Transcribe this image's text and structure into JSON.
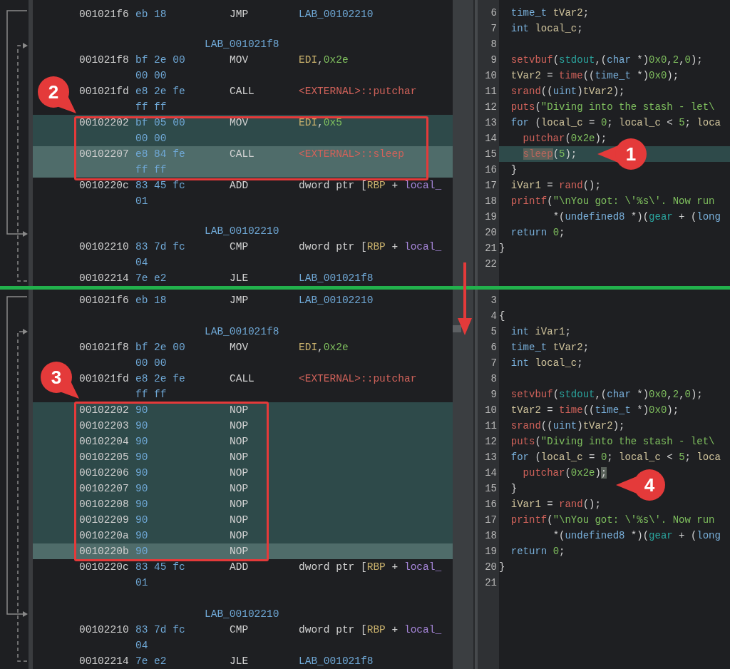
{
  "panes": [
    {
      "listing": {
        "rows": [
          {
            "kind": "instruction",
            "address": "001021f6",
            "bytes": [
              "eb 18"
            ],
            "mnemonic": "JMP",
            "operands": [
              {
                "text": "LAB_00102210",
                "kind": "label"
              }
            ],
            "selected": false,
            "cursor": false
          },
          {
            "kind": "blank",
            "selected": false,
            "cursor": false
          },
          {
            "kind": "label",
            "text": "LAB_001021f8",
            "selected": false,
            "cursor": false
          },
          {
            "kind": "instruction",
            "address": "001021f8",
            "bytes": [
              "bf 2e 00",
              "00 00"
            ],
            "mnemonic": "MOV",
            "operands": [
              {
                "text": "EDI",
                "kind": "register"
              },
              {
                "text": ",",
                "kind": "plain"
              },
              {
                "text": "0x2e",
                "kind": "number"
              }
            ],
            "selected": false,
            "cursor": false
          },
          {
            "kind": "instruction",
            "address": "001021fd",
            "bytes": [
              "e8 2e fe",
              "ff ff"
            ],
            "mnemonic": "CALL",
            "operands": [
              {
                "text": "<EXTERNAL>::putchar",
                "kind": "external"
              }
            ],
            "selected": false,
            "cursor": false
          },
          {
            "kind": "instruction",
            "address": "00102202",
            "bytes": [
              "bf 05 00",
              "00 00"
            ],
            "mnemonic": "MOV",
            "operands": [
              {
                "text": "EDI",
                "kind": "register"
              },
              {
                "text": ",",
                "kind": "plain"
              },
              {
                "text": "0x5",
                "kind": "number"
              }
            ],
            "selected": true,
            "cursor": false
          },
          {
            "kind": "instruction",
            "address": "00102207",
            "bytes": [
              "e8 84 fe",
              "ff ff"
            ],
            "mnemonic": "CALL",
            "operands": [
              {
                "text": "<EXTERNAL>::sleep",
                "kind": "external"
              }
            ],
            "selected": true,
            "cursor": true
          },
          {
            "kind": "instruction",
            "address": "0010220c",
            "bytes": [
              "83 45 fc",
              "01"
            ],
            "mnemonic": "ADD",
            "operands": [
              {
                "text": "dword ptr [",
                "kind": "plain"
              },
              {
                "text": "RBP",
                "kind": "register"
              },
              {
                "text": " + ",
                "kind": "plain"
              },
              {
                "text": "local_",
                "kind": "variable"
              }
            ],
            "selected": false,
            "cursor": false
          },
          {
            "kind": "blank",
            "selected": false,
            "cursor": false
          },
          {
            "kind": "label",
            "text": "LAB_00102210",
            "selected": false,
            "cursor": false
          },
          {
            "kind": "instruction",
            "address": "00102210",
            "bytes": [
              "83 7d fc",
              "04"
            ],
            "mnemonic": "CMP",
            "operands": [
              {
                "text": "dword ptr [",
                "kind": "plain"
              },
              {
                "text": "RBP",
                "kind": "register"
              },
              {
                "text": " + ",
                "kind": "plain"
              },
              {
                "text": "local_",
                "kind": "variable"
              }
            ],
            "selected": false,
            "cursor": false
          },
          {
            "kind": "instruction",
            "address": "00102214",
            "bytes": [
              "7e e2"
            ],
            "mnemonic": "JLE",
            "operands": [
              {
                "text": "LAB_001021f8",
                "kind": "label"
              }
            ],
            "selected": false,
            "cursor": false
          }
        ]
      },
      "decompiler": {
        "lines": [
          {
            "number": "6",
            "selected": false,
            "tokens": [
              {
                "text": "  time_t",
                "kind": "type"
              },
              {
                "text": " tVar2",
                "kind": "var"
              },
              {
                "text": ";",
                "kind": "plain"
              }
            ]
          },
          {
            "number": "7",
            "selected": false,
            "tokens": [
              {
                "text": "  int",
                "kind": "type"
              },
              {
                "text": " local_c",
                "kind": "var"
              },
              {
                "text": ";",
                "kind": "plain"
              }
            ]
          },
          {
            "number": "8",
            "selected": false
          },
          {
            "number": "9",
            "selected": false,
            "tokens": [
              {
                "text": "  setvbuf",
                "kind": "func"
              },
              {
                "text": "(",
                "kind": "plain"
              },
              {
                "text": "stdout",
                "kind": "global"
              },
              {
                "text": ",(",
                "kind": "plain"
              },
              {
                "text": "char",
                "kind": "type"
              },
              {
                "text": " *)",
                "kind": "plain"
              },
              {
                "text": "0x0",
                "kind": "number"
              },
              {
                "text": ",",
                "kind": "plain"
              },
              {
                "text": "2",
                "kind": "number"
              },
              {
                "text": ",",
                "kind": "plain"
              },
              {
                "text": "0",
                "kind": "number"
              },
              {
                "text": ");",
                "kind": "plain"
              }
            ]
          },
          {
            "number": "10",
            "selected": false,
            "tokens": [
              {
                "text": "  tVar2",
                "kind": "var"
              },
              {
                "text": " =",
                "kind": "plain"
              },
              {
                "text": " time",
                "kind": "func"
              },
              {
                "text": "((",
                "kind": "plain"
              },
              {
                "text": "time_t",
                "kind": "type"
              },
              {
                "text": " *)",
                "kind": "plain"
              },
              {
                "text": "0x0",
                "kind": "number"
              },
              {
                "text": ");",
                "kind": "plain"
              }
            ]
          },
          {
            "number": "11",
            "selected": false,
            "tokens": [
              {
                "text": "  srand",
                "kind": "func"
              },
              {
                "text": "((",
                "kind": "plain"
              },
              {
                "text": "uint",
                "kind": "type"
              },
              {
                "text": ")",
                "kind": "plain"
              },
              {
                "text": "tVar2",
                "kind": "var"
              },
              {
                "text": ");",
                "kind": "plain"
              }
            ]
          },
          {
            "number": "12",
            "selected": false,
            "tokens": [
              {
                "text": "  puts",
                "kind": "func"
              },
              {
                "text": "(",
                "kind": "plain"
              },
              {
                "text": "\"Diving into the stash - let\\",
                "kind": "string"
              }
            ]
          },
          {
            "number": "13",
            "selected": false,
            "tokens": [
              {
                "text": "  for",
                "kind": "type"
              },
              {
                "text": " (",
                "kind": "plain"
              },
              {
                "text": "local_c",
                "kind": "var"
              },
              {
                "text": " =",
                "kind": "plain"
              },
              {
                "text": " 0",
                "kind": "number"
              },
              {
                "text": ";",
                "kind": "plain"
              },
              {
                "text": " local_c",
                "kind": "var"
              },
              {
                "text": " <",
                "kind": "plain"
              },
              {
                "text": " 5",
                "kind": "number"
              },
              {
                "text": ";",
                "kind": "plain"
              },
              {
                "text": " loca",
                "kind": "var"
              }
            ]
          },
          {
            "number": "14",
            "selected": false,
            "tokens": [
              {
                "text": "    putchar",
                "kind": "func"
              },
              {
                "text": "(",
                "kind": "plain"
              },
              {
                "text": "0x2e",
                "kind": "number"
              },
              {
                "text": ");",
                "kind": "plain"
              }
            ]
          },
          {
            "number": "15",
            "selected": true,
            "tokens": [
              {
                "text": "    sleep",
                "kind": "markedfunc"
              },
              {
                "text": "(",
                "kind": "plain"
              },
              {
                "text": "5",
                "kind": "number"
              },
              {
                "text": ");",
                "kind": "plain"
              }
            ]
          },
          {
            "number": "16",
            "selected": false,
            "tokens": [
              {
                "text": "  }",
                "kind": "plain"
              }
            ]
          },
          {
            "number": "17",
            "selected": false,
            "tokens": [
              {
                "text": "  iVar1",
                "kind": "var"
              },
              {
                "text": " =",
                "kind": "plain"
              },
              {
                "text": " rand",
                "kind": "func"
              },
              {
                "text": "();",
                "kind": "plain"
              }
            ]
          },
          {
            "number": "18",
            "selected": false,
            "tokens": [
              {
                "text": "  printf",
                "kind": "func"
              },
              {
                "text": "(",
                "kind": "plain"
              },
              {
                "text": "\"\\nYou got: \\'%s\\'. Now run",
                "kind": "string"
              }
            ]
          },
          {
            "number": "19",
            "selected": false,
            "tokens": [
              {
                "text": "         *(",
                "kind": "plain"
              },
              {
                "text": "undefined8",
                "kind": "type"
              },
              {
                "text": " *)(",
                "kind": "plain"
              },
              {
                "text": "gear",
                "kind": "global"
              },
              {
                "text": " + (",
                "kind": "plain"
              },
              {
                "text": "long",
                "kind": "type"
              }
            ]
          },
          {
            "number": "20",
            "selected": false,
            "tokens": [
              {
                "text": "  return",
                "kind": "type"
              },
              {
                "text": " 0",
                "kind": "number"
              },
              {
                "text": ";",
                "kind": "plain"
              }
            ]
          },
          {
            "number": "21",
            "selected": false,
            "tokens": [
              {
                "text": "}",
                "kind": "plain"
              }
            ]
          },
          {
            "number": "22",
            "selected": false
          }
        ]
      }
    },
    {
      "listing": {
        "rows": [
          {
            "kind": "instruction",
            "address": "001021f6",
            "bytes": [
              "eb 18"
            ],
            "mnemonic": "JMP",
            "operands": [
              {
                "text": "LAB_00102210",
                "kind": "label"
              }
            ],
            "selected": false,
            "cursor": false
          },
          {
            "kind": "blank",
            "selected": false,
            "cursor": false
          },
          {
            "kind": "label",
            "text": "LAB_001021f8",
            "selected": false,
            "cursor": false
          },
          {
            "kind": "instruction",
            "address": "001021f8",
            "bytes": [
              "bf 2e 00",
              "00 00"
            ],
            "mnemonic": "MOV",
            "operands": [
              {
                "text": "EDI",
                "kind": "register"
              },
              {
                "text": ",",
                "kind": "plain"
              },
              {
                "text": "0x2e",
                "kind": "number"
              }
            ],
            "selected": false,
            "cursor": false
          },
          {
            "kind": "instruction",
            "address": "001021fd",
            "bytes": [
              "e8 2e fe",
              "ff ff"
            ],
            "mnemonic": "CALL",
            "operands": [
              {
                "text": "<EXTERNAL>::putchar",
                "kind": "external"
              }
            ],
            "selected": false,
            "cursor": false
          },
          {
            "kind": "instruction",
            "address": "00102202",
            "bytes": [
              "90"
            ],
            "mnemonic": "NOP",
            "selected": true,
            "cursor": false
          },
          {
            "kind": "instruction",
            "address": "00102203",
            "bytes": [
              "90"
            ],
            "mnemonic": "NOP",
            "selected": true,
            "cursor": false
          },
          {
            "kind": "instruction",
            "address": "00102204",
            "bytes": [
              "90"
            ],
            "mnemonic": "NOP",
            "selected": true,
            "cursor": false
          },
          {
            "kind": "instruction",
            "address": "00102205",
            "bytes": [
              "90"
            ],
            "mnemonic": "NOP",
            "selected": true,
            "cursor": false
          },
          {
            "kind": "instruction",
            "address": "00102206",
            "bytes": [
              "90"
            ],
            "mnemonic": "NOP",
            "selected": true,
            "cursor": false
          },
          {
            "kind": "instruction",
            "address": "00102207",
            "bytes": [
              "90"
            ],
            "mnemonic": "NOP",
            "selected": true,
            "cursor": false
          },
          {
            "kind": "instruction",
            "address": "00102208",
            "bytes": [
              "90"
            ],
            "mnemonic": "NOP",
            "selected": true,
            "cursor": false
          },
          {
            "kind": "instruction",
            "address": "00102209",
            "bytes": [
              "90"
            ],
            "mnemonic": "NOP",
            "selected": true,
            "cursor": false
          },
          {
            "kind": "instruction",
            "address": "0010220a",
            "bytes": [
              "90"
            ],
            "mnemonic": "NOP",
            "selected": true,
            "cursor": false
          },
          {
            "kind": "instruction",
            "address": "0010220b",
            "bytes": [
              "90"
            ],
            "mnemonic": "NOP",
            "selected": true,
            "cursor": true
          },
          {
            "kind": "instruction",
            "address": "0010220c",
            "bytes": [
              "83 45 fc",
              "01"
            ],
            "mnemonic": "ADD",
            "operands": [
              {
                "text": "dword ptr [",
                "kind": "plain"
              },
              {
                "text": "RBP",
                "kind": "register"
              },
              {
                "text": " + ",
                "kind": "plain"
              },
              {
                "text": "local_",
                "kind": "variable"
              }
            ],
            "selected": false,
            "cursor": false
          },
          {
            "kind": "blank",
            "selected": false,
            "cursor": false
          },
          {
            "kind": "label",
            "text": "LAB_00102210",
            "selected": false,
            "cursor": false
          },
          {
            "kind": "instruction",
            "address": "00102210",
            "bytes": [
              "83 7d fc",
              "04"
            ],
            "mnemonic": "CMP",
            "operands": [
              {
                "text": "dword ptr [",
                "kind": "plain"
              },
              {
                "text": "RBP",
                "kind": "register"
              },
              {
                "text": " + ",
                "kind": "plain"
              },
              {
                "text": "local_",
                "kind": "variable"
              }
            ],
            "selected": false,
            "cursor": false
          },
          {
            "kind": "instruction",
            "address": "00102214",
            "bytes": [
              "7e e2"
            ],
            "mnemonic": "JLE",
            "operands": [
              {
                "text": "LAB_001021f8",
                "kind": "label"
              }
            ],
            "selected": false,
            "cursor": false
          }
        ]
      },
      "decompiler": {
        "lines": [
          {
            "number": "3",
            "selected": false
          },
          {
            "number": "4",
            "selected": false,
            "tokens": [
              {
                "text": "{",
                "kind": "plain"
              }
            ]
          },
          {
            "number": "5",
            "selected": false,
            "tokens": [
              {
                "text": "  int",
                "kind": "type"
              },
              {
                "text": " iVar1",
                "kind": "var"
              },
              {
                "text": ";",
                "kind": "plain"
              }
            ]
          },
          {
            "number": "6",
            "selected": false,
            "tokens": [
              {
                "text": "  time_t",
                "kind": "type"
              },
              {
                "text": " tVar2",
                "kind": "var"
              },
              {
                "text": ";",
                "kind": "plain"
              }
            ]
          },
          {
            "number": "7",
            "selected": false,
            "tokens": [
              {
                "text": "  int",
                "kind": "type"
              },
              {
                "text": " local_c",
                "kind": "var"
              },
              {
                "text": ";",
                "kind": "plain"
              }
            ]
          },
          {
            "number": "8",
            "selected": false
          },
          {
            "number": "9",
            "selected": false,
            "tokens": [
              {
                "text": "  setvbuf",
                "kind": "func"
              },
              {
                "text": "(",
                "kind": "plain"
              },
              {
                "text": "stdout",
                "kind": "global"
              },
              {
                "text": ",(",
                "kind": "plain"
              },
              {
                "text": "char",
                "kind": "type"
              },
              {
                "text": " *)",
                "kind": "plain"
              },
              {
                "text": "0x0",
                "kind": "number"
              },
              {
                "text": ",",
                "kind": "plain"
              },
              {
                "text": "2",
                "kind": "number"
              },
              {
                "text": ",",
                "kind": "plain"
              },
              {
                "text": "0",
                "kind": "number"
              },
              {
                "text": ");",
                "kind": "plain"
              }
            ]
          },
          {
            "number": "10",
            "selected": false,
            "tokens": [
              {
                "text": "  tVar2",
                "kind": "var"
              },
              {
                "text": " =",
                "kind": "plain"
              },
              {
                "text": " time",
                "kind": "func"
              },
              {
                "text": "((",
                "kind": "plain"
              },
              {
                "text": "time_t",
                "kind": "type"
              },
              {
                "text": " *)",
                "kind": "plain"
              },
              {
                "text": "0x0",
                "kind": "number"
              },
              {
                "text": ");",
                "kind": "plain"
              }
            ]
          },
          {
            "number": "11",
            "selected": false,
            "tokens": [
              {
                "text": "  srand",
                "kind": "func"
              },
              {
                "text": "((",
                "kind": "plain"
              },
              {
                "text": "uint",
                "kind": "type"
              },
              {
                "text": ")",
                "kind": "plain"
              },
              {
                "text": "tVar2",
                "kind": "var"
              },
              {
                "text": ");",
                "kind": "plain"
              }
            ]
          },
          {
            "number": "12",
            "selected": false,
            "tokens": [
              {
                "text": "  puts",
                "kind": "func"
              },
              {
                "text": "(",
                "kind": "plain"
              },
              {
                "text": "\"Diving into the stash - let\\",
                "kind": "string"
              }
            ]
          },
          {
            "number": "13",
            "selected": false,
            "tokens": [
              {
                "text": "  for",
                "kind": "type"
              },
              {
                "text": " (",
                "kind": "plain"
              },
              {
                "text": "local_c",
                "kind": "var"
              },
              {
                "text": " =",
                "kind": "plain"
              },
              {
                "text": " 0",
                "kind": "number"
              },
              {
                "text": ";",
                "kind": "plain"
              },
              {
                "text": " local_c",
                "kind": "var"
              },
              {
                "text": " <",
                "kind": "plain"
              },
              {
                "text": " 5",
                "kind": "number"
              },
              {
                "text": ";",
                "kind": "plain"
              },
              {
                "text": " loca",
                "kind": "var"
              }
            ]
          },
          {
            "number": "14",
            "selected": false,
            "tokens": [
              {
                "text": "    putchar",
                "kind": "func"
              },
              {
                "text": "(",
                "kind": "plain"
              },
              {
                "text": "0x2e",
                "kind": "number"
              },
              {
                "text": ")",
                "kind": "plain"
              },
              {
                "text": ";",
                "kind": "markedplain"
              }
            ]
          },
          {
            "number": "15",
            "selected": false,
            "tokens": [
              {
                "text": "  }",
                "kind": "plain"
              }
            ]
          },
          {
            "number": "16",
            "selected": false,
            "tokens": [
              {
                "text": "  iVar1",
                "kind": "var"
              },
              {
                "text": " =",
                "kind": "plain"
              },
              {
                "text": " rand",
                "kind": "func"
              },
              {
                "text": "();",
                "kind": "plain"
              }
            ]
          },
          {
            "number": "17",
            "selected": false,
            "tokens": [
              {
                "text": "  printf",
                "kind": "func"
              },
              {
                "text": "(",
                "kind": "plain"
              },
              {
                "text": "\"\\nYou got: \\'%s\\'. Now run",
                "kind": "string"
              }
            ]
          },
          {
            "number": "18",
            "selected": false,
            "tokens": [
              {
                "text": "         *(",
                "kind": "plain"
              },
              {
                "text": "undefined8",
                "kind": "type"
              },
              {
                "text": " *)(",
                "kind": "plain"
              },
              {
                "text": "gear",
                "kind": "global"
              },
              {
                "text": " + (",
                "kind": "plain"
              },
              {
                "text": "long",
                "kind": "type"
              }
            ]
          },
          {
            "number": "19",
            "selected": false,
            "tokens": [
              {
                "text": "  return",
                "kind": "type"
              },
              {
                "text": " 0",
                "kind": "number"
              },
              {
                "text": ";",
                "kind": "plain"
              }
            ]
          },
          {
            "number": "20",
            "selected": false,
            "tokens": [
              {
                "text": "}",
                "kind": "plain"
              }
            ]
          },
          {
            "number": "21",
            "selected": false
          }
        ]
      }
    }
  ],
  "annotations": [
    {
      "label": "1"
    },
    {
      "label": "2"
    },
    {
      "label": "3"
    },
    {
      "label": "4"
    }
  ]
}
